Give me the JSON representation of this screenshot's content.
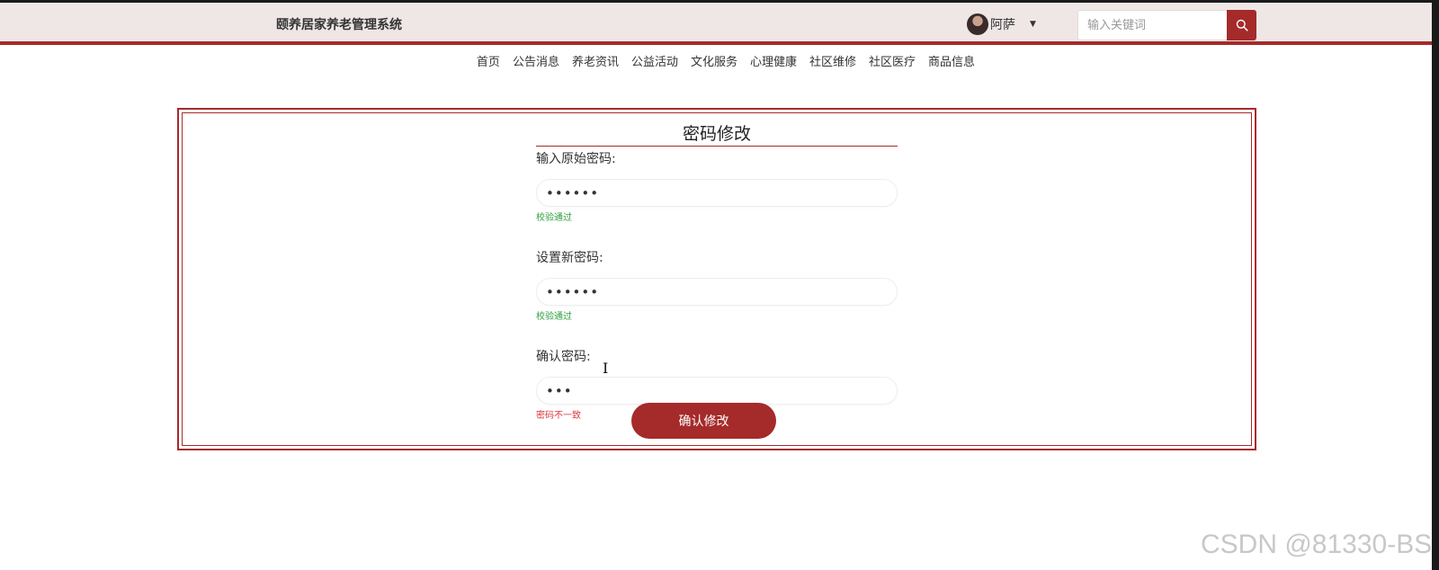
{
  "header": {
    "app_title": "颐养居家养老管理系统",
    "user": {
      "name": "阿萨",
      "avatar_icon": "avatar-photo",
      "dropdown_icon": "caret-down-icon"
    },
    "search": {
      "placeholder": "输入关键词",
      "value": "",
      "icon": "search-icon"
    },
    "accent_color": "#a52a2a",
    "background_color": "#efe6e6"
  },
  "nav": {
    "items": [
      "首页",
      "公告消息",
      "养老资讯",
      "公益活动",
      "文化服务",
      "心理健康",
      "社区维修",
      "社区医疗",
      "商品信息"
    ]
  },
  "form": {
    "title": "密码修改",
    "fields": [
      {
        "label": "输入原始密码:",
        "value": "••••••",
        "hint": "校验通过",
        "hint_status": "success"
      },
      {
        "label": "设置新密码:",
        "value": "••••••",
        "hint": "校验通过",
        "hint_status": "success"
      },
      {
        "label": "确认密码:",
        "value": "•••",
        "hint": "密码不一致",
        "hint_status": "error"
      }
    ],
    "submit_label": "确认修改"
  },
  "watermark": "CSDN @81330-BS"
}
